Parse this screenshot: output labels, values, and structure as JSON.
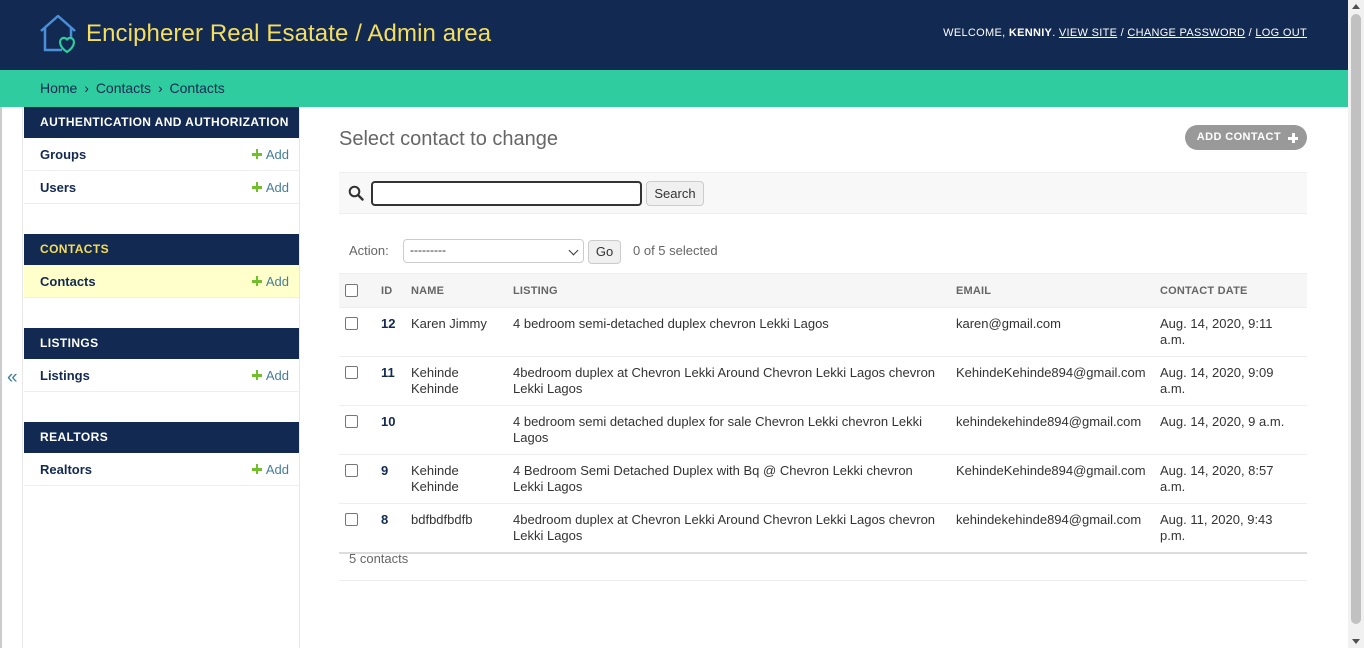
{
  "header": {
    "title": "Encipherer Real Esatate / Admin area",
    "welcome": "WELCOME,",
    "username": "KENNIY",
    "view_site": "VIEW SITE",
    "change_password": "CHANGE PASSWORD",
    "log_out": "LOG OUT",
    "sep": "/",
    "brand_color": "#f5dd5d",
    "header_bg": "#122952"
  },
  "breadcrumbs": {
    "items": [
      "Home",
      "Contacts",
      "Contacts"
    ],
    "sep": "›",
    "bg": "#2ecc9e"
  },
  "sidebar": {
    "toggle": "«",
    "modules": [
      {
        "caption": "Authentication and Authorization",
        "rows": [
          {
            "label": "Groups",
            "add": "Add"
          },
          {
            "label": "Users",
            "add": "Add"
          }
        ]
      },
      {
        "caption": "Contacts",
        "rows": [
          {
            "label": "Contacts",
            "add": "Add"
          }
        ]
      },
      {
        "caption": "Listings",
        "rows": [
          {
            "label": "Listings",
            "add": "Add"
          }
        ]
      },
      {
        "caption": "Realtors",
        "rows": [
          {
            "label": "Realtors",
            "add": "Add"
          }
        ]
      }
    ]
  },
  "main": {
    "title": "Select contact to change",
    "add_button": "ADD CONTACT",
    "search": {
      "value": "",
      "button": "Search"
    },
    "actions": {
      "label": "Action:",
      "selected": "---------",
      "go": "Go",
      "counter": "0 of 5 selected"
    },
    "table": {
      "headers": [
        "ID",
        "NAME",
        "LISTING",
        "EMAIL",
        "CONTACT DATE"
      ],
      "rows": [
        {
          "id": "12",
          "name": "Karen Jimmy",
          "listing": "4 bedroom semi-detached duplex chevron Lekki Lagos",
          "email": "karen@gmail.com",
          "date": "Aug. 14, 2020, 9:11 a.m."
        },
        {
          "id": "11",
          "name": "Kehinde Kehinde",
          "listing": "4bedroom duplex at Chevron Lekki Around Chevron Lekki Lagos chevron Lekki Lagos",
          "email": "KehindeKehinde894@gmail.com",
          "date": "Aug. 14, 2020, 9:09 a.m."
        },
        {
          "id": "10",
          "name": "",
          "listing": "4 bedroom semi detached duplex for sale Chevron Lekki chevron Lekki Lagos",
          "email": "kehindekehinde894@gmail.com",
          "date": "Aug. 14, 2020, 9 a.m."
        },
        {
          "id": "9",
          "name": "Kehinde Kehinde",
          "listing": "4 Bedroom Semi Detached Duplex with Bq @ Chevron Lekki chevron Lekki Lagos",
          "email": "KehindeKehinde894@gmail.com",
          "date": "Aug. 14, 2020, 8:57 a.m."
        },
        {
          "id": "8",
          "name": "bdfbdfbdfb",
          "listing": "4bedroom duplex at Chevron Lekki Around Chevron Lekki Lagos chevron Lekki Lagos",
          "email": "kehindekehinde894@gmail.com",
          "date": "Aug. 11, 2020, 9:43 p.m."
        }
      ]
    },
    "paginator": "5 contacts"
  }
}
